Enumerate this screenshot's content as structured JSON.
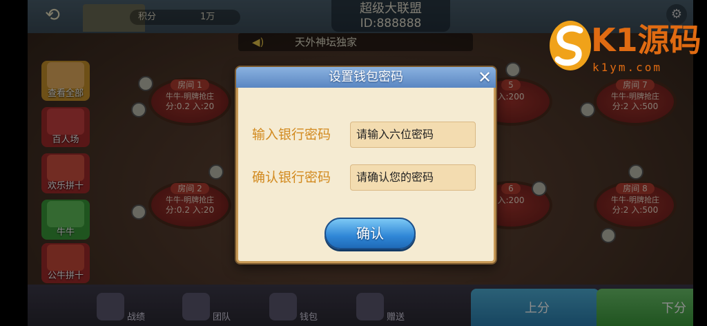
{
  "header": {
    "score_label": "积分",
    "score_value": "1万",
    "alliance_name": "超级大联盟",
    "alliance_id": "ID:888888"
  },
  "marquee": {
    "text": "天外神坛独家"
  },
  "left_menu": [
    {
      "label": "查看全部"
    },
    {
      "label": "百人场"
    },
    {
      "label": "欢乐拼十"
    },
    {
      "label": "牛牛"
    },
    {
      "label": "公牛拼十"
    }
  ],
  "tables": [
    {
      "room": "房间 1",
      "mode": "牛牛-明牌抢庄",
      "stake": "分:0.2  入:20"
    },
    {
      "room": "房间 2",
      "mode": "牛牛-明牌抢庄",
      "stake": "分:0.2  入:20"
    },
    {
      "room": "5",
      "mode": "",
      "stake": "入:200"
    },
    {
      "room": "6",
      "mode": "",
      "stake": "入:200"
    },
    {
      "room": "房间 7",
      "mode": "牛牛-明牌抢庄",
      "stake": "分:2  入:500"
    },
    {
      "room": "房间 8",
      "mode": "牛牛-明牌抢庄",
      "stake": "分:2  入:500"
    }
  ],
  "bottom_nav": [
    {
      "label": "战绩",
      "icon": "trophy-icon"
    },
    {
      "label": "团队",
      "icon": "team-icon"
    },
    {
      "label": "钱包",
      "icon": "wallet-icon"
    },
    {
      "label": "赠送",
      "icon": "gift-icon"
    }
  ],
  "actions": {
    "deposit_label": "上分",
    "withdraw_label": "下分"
  },
  "dialog": {
    "title": "设置钱包密码",
    "field1_label": "输入银行密码",
    "field1_placeholder": "请输入六位密码",
    "field2_label": "确认银行密码",
    "field2_placeholder": "请确认您的密码",
    "confirm_label": "确认"
  },
  "watermark": {
    "brand": "K1源码",
    "url": "k1ym.com"
  },
  "colors": {
    "dialog_bg": "#f5ebd2",
    "dialog_header": "#6a93cc",
    "label_orange": "#d28a1f",
    "confirm_blue": "#2f86d6",
    "watermark_orange": "#e06b12"
  }
}
